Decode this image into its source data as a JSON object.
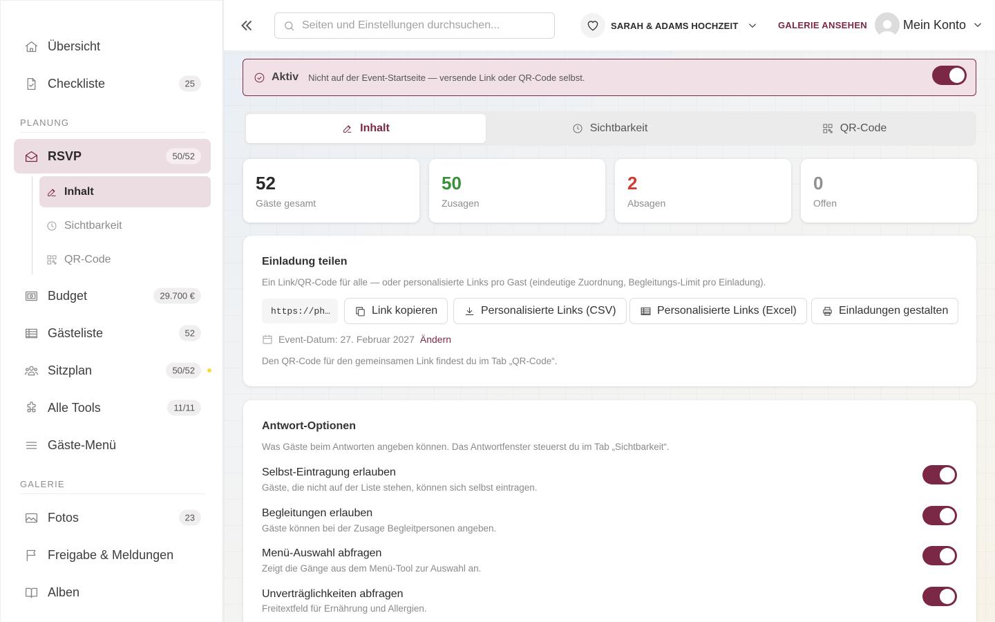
{
  "sidebar": {
    "items": [
      {
        "label": "Übersicht",
        "icon": "home-icon"
      },
      {
        "label": "Checkliste",
        "badge": "25",
        "icon": "checklist-icon"
      },
      {
        "label": "RSVP",
        "badge": "50/52",
        "icon": "envelope-icon"
      },
      {
        "label": "Budget",
        "badge": "29.700 €",
        "icon": "budget-icon"
      },
      {
        "label": "Gästeliste",
        "badge": "52",
        "icon": "guestlist-icon"
      },
      {
        "label": "Sitzplan",
        "badge": "50/52",
        "icon": "people-icon"
      },
      {
        "label": "Alle Tools",
        "badge": "11/11",
        "icon": "puzzle-icon"
      },
      {
        "label": "Gäste-Menü",
        "icon": "menu-lines-icon"
      },
      {
        "label": "Fotos",
        "badge": "23",
        "icon": "image-icon"
      },
      {
        "label": "Freigabe & Meldungen",
        "icon": "flag-icon"
      },
      {
        "label": "Alben",
        "icon": "book-icon"
      }
    ],
    "sections": {
      "planning": "PLANUNG",
      "gallery": "GALERIE"
    },
    "rsvp_sub": [
      {
        "label": "Inhalt",
        "icon": "edit-icon"
      },
      {
        "label": "Sichtbarkeit",
        "icon": "clock-icon"
      },
      {
        "label": "QR-Code",
        "icon": "qr-icon"
      }
    ]
  },
  "topbar": {
    "search_placeholder": "Seiten und Einstellungen durchsuchen...",
    "event_name": "SARAH & ADAMS HOCHZEIT",
    "gallery_link": "GALERIE ANSEHEN",
    "account_label": "Mein Konto"
  },
  "banner": {
    "status": "Aktiv",
    "message": "Nicht auf der Event-Startseite — versende Link oder QR-Code selbst.",
    "enabled": true
  },
  "tabs": [
    {
      "label": "Inhalt",
      "active": true
    },
    {
      "label": "Sichtbarkeit",
      "active": false
    },
    {
      "label": "QR-Code",
      "active": false
    }
  ],
  "stats": [
    {
      "value": "52",
      "label": "Gäste gesamt",
      "color": "#2a2a2a"
    },
    {
      "value": "50",
      "label": "Zusagen",
      "color": "#3a8f3a"
    },
    {
      "value": "2",
      "label": "Absagen",
      "color": "#d23b32"
    },
    {
      "value": "0",
      "label": "Offen",
      "color": "#909090"
    }
  ],
  "share": {
    "title": "Einladung teilen",
    "description": "Ein Link/QR-Code für alle — oder personalisierte Links pro Gast (eindeutige Zuordnung, Begleitungs-Limit pro Einladung).",
    "url_preview": "https://ph…",
    "buttons": {
      "copy": "Link kopieren",
      "csv": "Personalisierte Links (CSV)",
      "excel": "Personalisierte Links (Excel)",
      "design": "Einladungen gestalten"
    },
    "event_date": "Event-Datum: 27. Februar 2027",
    "change_link": "Ändern",
    "qr_note": "Den QR-Code für den gemeinsamen Link findest du im Tab „QR-Code“."
  },
  "options": {
    "title": "Antwort-Optionen",
    "description": "Was Gäste beim Antworten angeben können. Das Antwortfenster steuerst du im Tab „Sichtbarkeit“.",
    "items": [
      {
        "title": "Selbst-Eintragung erlauben",
        "desc": "Gäste, die nicht auf der Liste stehen, können sich selbst eintragen.",
        "enabled": true
      },
      {
        "title": "Begleitungen erlauben",
        "desc": "Gäste können bei der Zusage Begleitpersonen angeben.",
        "enabled": true
      },
      {
        "title": "Menü-Auswahl abfragen",
        "desc": "Zeigt die Gänge aus dem Menü-Tool zur Auswahl an.",
        "enabled": true
      },
      {
        "title": "Unverträglichkeiten abfragen",
        "desc": "Freitextfeld für Ernährung und Allergien.",
        "enabled": true
      }
    ]
  },
  "colors": {
    "accent": "#7a2846",
    "accent_light": "#ecdde2",
    "success": "#3a8f3a",
    "danger": "#d23b32"
  }
}
